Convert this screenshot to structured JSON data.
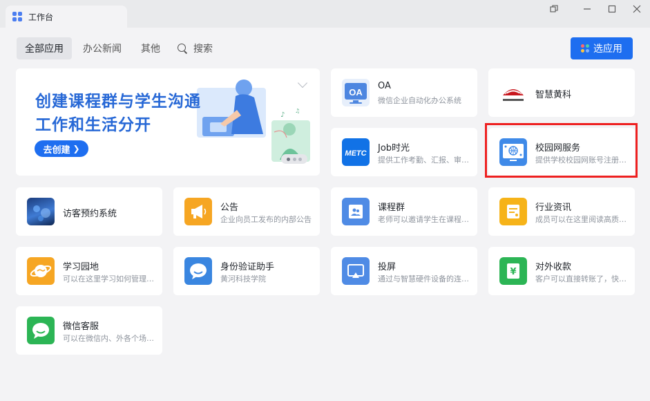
{
  "window": {
    "tab_title": "工作台",
    "controls": [
      "restore-icon",
      "minimize-icon",
      "maximize-icon",
      "close-icon"
    ]
  },
  "toolbar": {
    "tabs": [
      {
        "label": "全部应用",
        "active": true
      },
      {
        "label": "办公新闻",
        "active": false
      },
      {
        "label": "其他",
        "active": false
      }
    ],
    "search_label": "搜索",
    "choose_button": "选应用"
  },
  "banner": {
    "line1": "创建课程群与学生沟通",
    "line2": "工作和生活分开",
    "cta": "去创建"
  },
  "apps": [
    {
      "name": "OA",
      "desc": "微信企业自动化办公系统",
      "icon": "oa-icon"
    },
    {
      "name": "智慧黄科",
      "desc": "",
      "icon": "huangke-logo"
    },
    {
      "name": "Job时光",
      "desc": "提供工作考勤、汇报、审批等功能",
      "icon": "metc-icon"
    },
    {
      "name": "校园网服务",
      "desc": "提供学校校园网账号注册服务",
      "icon": "campus-network-icon"
    },
    {
      "name": "访客预约系统",
      "desc": "",
      "icon": "visitor-icon"
    },
    {
      "name": "公告",
      "desc": "企业向员工发布的内部公告",
      "icon": "megaphone-icon"
    },
    {
      "name": "课程群",
      "desc": "老师可以邀请学生在课程群沟通",
      "icon": "course-group-icon"
    },
    {
      "name": "行业资讯",
      "desc": "成员可以在这里阅读高质量资讯",
      "icon": "news-icon"
    },
    {
      "name": "学习园地",
      "desc": "可以在这里学习如何管理企业",
      "icon": "planet-icon"
    },
    {
      "name": "身份验证助手",
      "desc": "黄河科技学院",
      "icon": "chat-bubble-icon"
    },
    {
      "name": "投屏",
      "desc": "通过与智慧硬件设备的连接投屏",
      "icon": "screen-cast-icon"
    },
    {
      "name": "对外收款",
      "desc": "客户可以直接转账了，快速收款",
      "icon": "yuan-icon"
    },
    {
      "name": "微信客服",
      "desc": "可以在微信内、外各个场景接入",
      "icon": "wechat-service-icon"
    }
  ],
  "colors": {
    "accent": "#1e6ef0",
    "highlight_border": "#ee2020",
    "banner_text": "#2768d6"
  }
}
